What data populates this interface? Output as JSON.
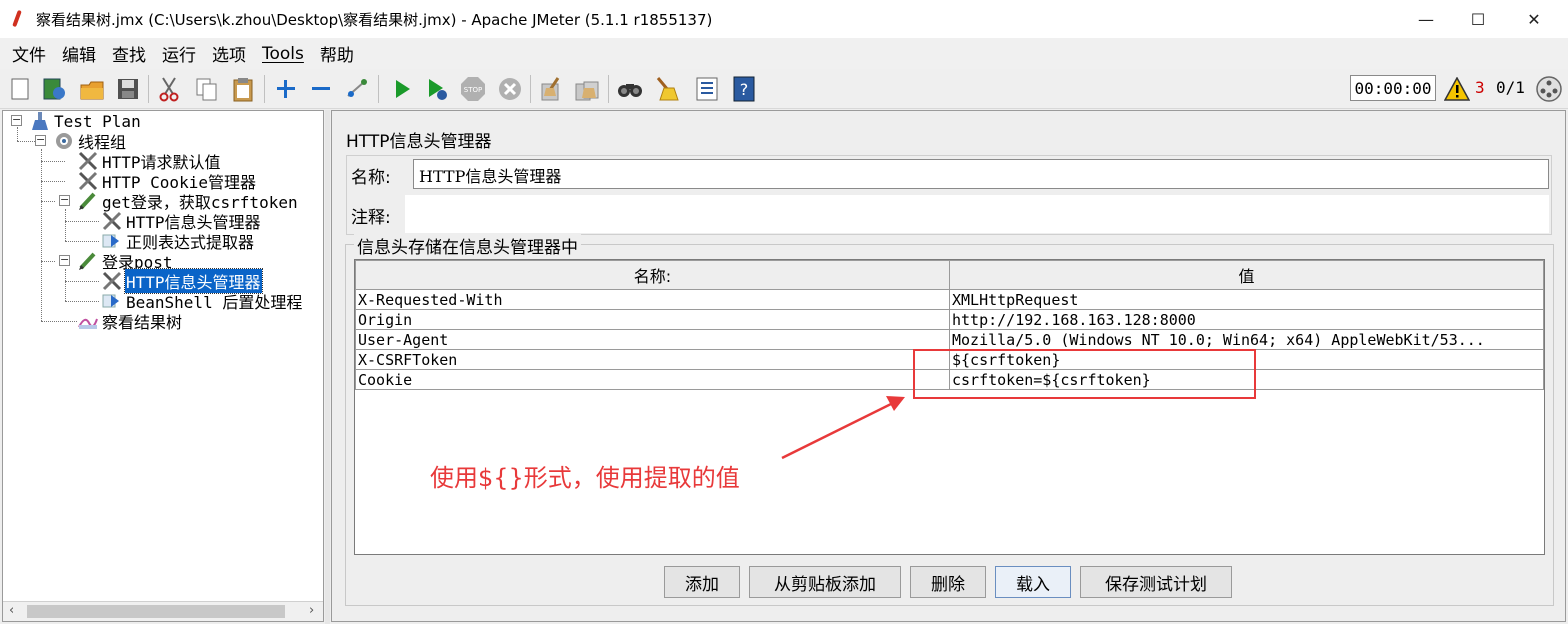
{
  "window": {
    "title": "察看结果树.jmx (C:\\Users\\k.zhou\\Desktop\\察看结果树.jmx) - Apache JMeter (5.1.1 r1855137)",
    "minimize": "—",
    "maximize": "☐",
    "close": "✕"
  },
  "menu": [
    "文件",
    "编辑",
    "查找",
    "运行",
    "选项",
    "Tools",
    "帮助"
  ],
  "toolbar": {
    "buttons": [
      "new-icon",
      "templates-icon",
      "open-icon",
      "save-icon",
      "cut-icon",
      "copy-icon",
      "paste-icon",
      "expand-icon",
      "collapse-icon",
      "toggle-icon",
      "start-icon",
      "start-no-pause-icon",
      "stop-icon",
      "shutdown-icon",
      "clear-icon",
      "clear-all-icon",
      "search-icon",
      "reset-search-icon",
      "function-helper-icon",
      "help-icon"
    ],
    "timer": "00:00:00",
    "warning_count": "3",
    "threads": "0/1"
  },
  "tree": {
    "root": "Test Plan",
    "thread_group": "线程组",
    "items": {
      "defaults": "HTTP请求默认值",
      "cookie": "HTTP Cookie管理器",
      "get_login": "get登录，获取csrftoken",
      "header_mgr_1": "HTTP信息头管理器",
      "regex": "正则表达式提取器",
      "login_post": "登录post",
      "header_mgr_2": "HTTP信息头管理器",
      "beanshell": "BeanShell 后置处理程",
      "results_tree": "察看结果树"
    }
  },
  "panel": {
    "title": "HTTP信息头管理器",
    "name_label": "名称:",
    "name_value": "HTTP信息头管理器",
    "comment_label": "注释:",
    "group_title": "信息头存储在信息头管理器中",
    "columns": [
      "名称:",
      "值"
    ],
    "rows": [
      [
        "X-Requested-With",
        "XMLHttpRequest"
      ],
      [
        "Origin",
        "http://192.168.163.128:8000"
      ],
      [
        "User-Agent",
        "Mozilla/5.0 (Windows NT 10.0; Win64; x64) AppleWebKit/53..."
      ],
      [
        "X-CSRFToken",
        "${csrftoken}"
      ],
      [
        "Cookie",
        "csrftoken=${csrftoken}"
      ]
    ],
    "buttons": {
      "add": "添加",
      "add_clipboard": "从剪贴板添加",
      "delete": "删除",
      "load": "载入",
      "save_plan": "保存测试计划"
    }
  },
  "annotation": {
    "text": "使用${}形式，使用提取的值",
    "color": "#e8393a"
  },
  "colors": {
    "selection": "#0a64c8",
    "title_bar": "#ffffff"
  }
}
